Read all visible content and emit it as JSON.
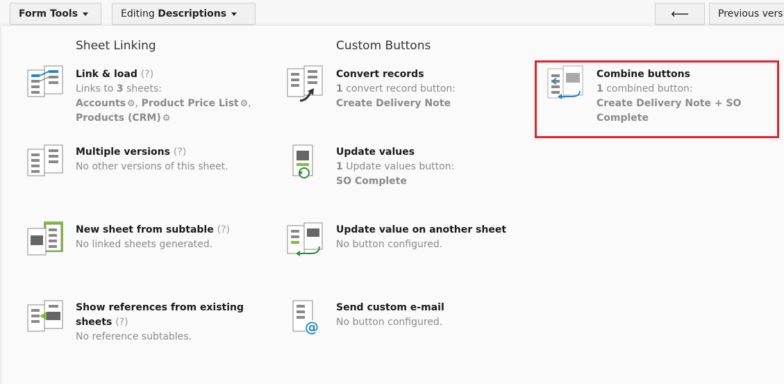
{
  "toolbar": {
    "form_tools": "Form Tools",
    "editing_prefix": "Editing",
    "editing_target": "Descriptions",
    "back_arrow": "⟵",
    "previous": "Previous versions"
  },
  "sheet_linking": {
    "header": "Sheet Linking",
    "link_load": {
      "title": "Link & load",
      "q": "(?)",
      "sub_prefix": "Links to",
      "count": "3",
      "sub_suffix": "sheets:",
      "sheet1": "Accounts",
      "sheet2": "Product Price List",
      "sheet3": "Products (CRM)"
    },
    "multi_versions": {
      "title": "Multiple versions",
      "q": "(?)",
      "sub": "No other versions of this sheet."
    },
    "new_sheet": {
      "title": "New sheet from subtable",
      "q": "(?)",
      "sub": "No linked sheets generated."
    },
    "show_refs": {
      "title_line1": "Show references from existing",
      "title_line2": "sheets",
      "q": "(?)",
      "sub": "No reference subtables."
    }
  },
  "custom_buttons": {
    "header": "Custom Buttons",
    "convert": {
      "title": "Convert records",
      "count": "1",
      "sub": "convert record button:",
      "value": "Create Delivery Note"
    },
    "update_values": {
      "title": "Update values",
      "count": "1",
      "sub": "Update values button:",
      "value": "SO Complete"
    },
    "update_other": {
      "title": "Update value on another sheet",
      "sub": "No button configured."
    },
    "send_email": {
      "title": "Send custom e-mail",
      "sub": "No button configured."
    },
    "combine": {
      "title": "Combine buttons",
      "count": "1",
      "sub": "combined button:",
      "value_line1": "Create Delivery Note + SO",
      "value_line2": "Complete"
    }
  },
  "colors": {
    "highlight": "#e0232b",
    "accent_blue": "#1f87c8",
    "accent_green": "#7dbb42"
  }
}
